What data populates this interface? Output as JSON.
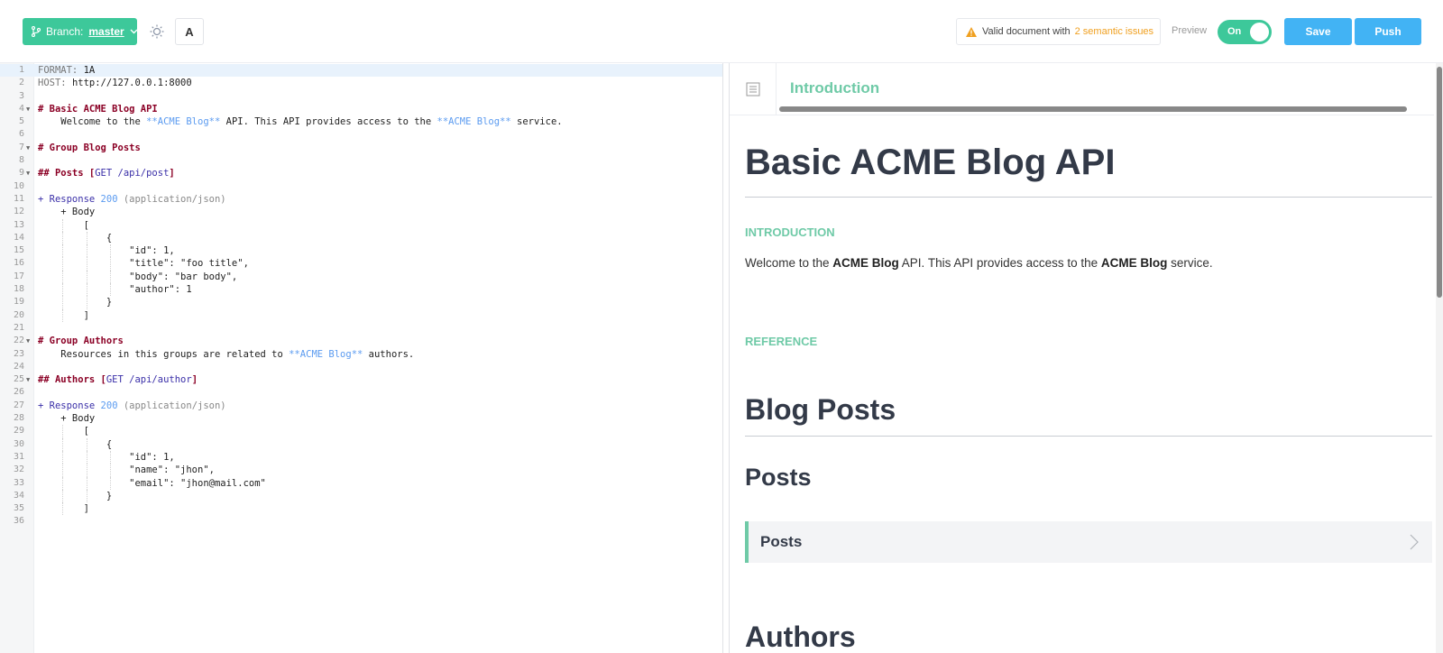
{
  "toolbar": {
    "branch_prefix": "Branch:",
    "branch_name": "master",
    "font_label": "A",
    "status_text": "Valid document with",
    "status_issues": "2 semantic issues",
    "preview_label": "Preview",
    "toggle_state": "On",
    "save_label": "Save",
    "push_label": "Push",
    "accent_color": "#3dc89a",
    "primary_color": "#42b3f4",
    "warning_color": "#f0a020"
  },
  "editor": {
    "lines": [
      {
        "n": "1",
        "fold": false,
        "active": true,
        "indent": 0,
        "parts": [
          {
            "t": "FORMAT: ",
            "c": "c-key"
          },
          {
            "t": "1A",
            "c": ""
          }
        ]
      },
      {
        "n": "2",
        "fold": false,
        "indent": 0,
        "parts": [
          {
            "t": "HOST: ",
            "c": "c-key"
          },
          {
            "t": "http://127.0.0.1:8000",
            "c": ""
          }
        ]
      },
      {
        "n": "3",
        "fold": false,
        "indent": 0,
        "parts": []
      },
      {
        "n": "4",
        "fold": true,
        "indent": 0,
        "parts": [
          {
            "t": "# Basic ACME Blog API",
            "c": "c-head"
          }
        ]
      },
      {
        "n": "5",
        "fold": false,
        "indent": 0,
        "parts": [
          {
            "t": "    Welcome to the ",
            "c": ""
          },
          {
            "t": "**ACME Blog**",
            "c": "c-link"
          },
          {
            "t": " API. This API provides access to the ",
            "c": ""
          },
          {
            "t": "**ACME Blog**",
            "c": "c-link"
          },
          {
            "t": " service.",
            "c": ""
          }
        ]
      },
      {
        "n": "6",
        "fold": false,
        "indent": 0,
        "parts": []
      },
      {
        "n": "7",
        "fold": true,
        "indent": 0,
        "parts": [
          {
            "t": "# Group Blog Posts",
            "c": "c-head"
          }
        ]
      },
      {
        "n": "8",
        "fold": false,
        "indent": 0,
        "parts": []
      },
      {
        "n": "9",
        "fold": true,
        "indent": 0,
        "parts": [
          {
            "t": "## Posts [",
            "c": "c-head"
          },
          {
            "t": "GET /api/post",
            "c": "c-path"
          },
          {
            "t": "]",
            "c": "c-head"
          }
        ]
      },
      {
        "n": "10",
        "fold": false,
        "indent": 0,
        "parts": []
      },
      {
        "n": "11",
        "fold": false,
        "indent": 0,
        "parts": [
          {
            "t": "+ Response ",
            "c": "c-plus"
          },
          {
            "t": "200",
            "c": "c-num"
          },
          {
            "t": " (application/json)",
            "c": "c-type"
          }
        ]
      },
      {
        "n": "12",
        "fold": false,
        "indent": 0,
        "parts": [
          {
            "t": "    + Body",
            "c": ""
          }
        ]
      },
      {
        "n": "13",
        "fold": false,
        "indent": 1,
        "parts": [
          {
            "t": "        [",
            "c": ""
          }
        ]
      },
      {
        "n": "14",
        "fold": false,
        "indent": 2,
        "parts": [
          {
            "t": "            {",
            "c": ""
          }
        ]
      },
      {
        "n": "15",
        "fold": false,
        "indent": 3,
        "parts": [
          {
            "t": "                \"id\": 1,",
            "c": ""
          }
        ]
      },
      {
        "n": "16",
        "fold": false,
        "indent": 3,
        "parts": [
          {
            "t": "                \"title\": \"foo title\",",
            "c": ""
          }
        ]
      },
      {
        "n": "17",
        "fold": false,
        "indent": 3,
        "parts": [
          {
            "t": "                \"body\": \"bar body\",",
            "c": ""
          }
        ]
      },
      {
        "n": "18",
        "fold": false,
        "indent": 3,
        "parts": [
          {
            "t": "                \"author\": 1",
            "c": ""
          }
        ]
      },
      {
        "n": "19",
        "fold": false,
        "indent": 2,
        "parts": [
          {
            "t": "            }",
            "c": ""
          }
        ]
      },
      {
        "n": "20",
        "fold": false,
        "indent": 1,
        "parts": [
          {
            "t": "        ]",
            "c": ""
          }
        ]
      },
      {
        "n": "21",
        "fold": false,
        "indent": 0,
        "parts": []
      },
      {
        "n": "22",
        "fold": true,
        "indent": 0,
        "parts": [
          {
            "t": "# Group Authors",
            "c": "c-head"
          }
        ]
      },
      {
        "n": "23",
        "fold": false,
        "indent": 0,
        "parts": [
          {
            "t": "    Resources in this groups are related to ",
            "c": ""
          },
          {
            "t": "**ACME Blog**",
            "c": "c-link"
          },
          {
            "t": " authors.",
            "c": ""
          }
        ]
      },
      {
        "n": "24",
        "fold": false,
        "indent": 0,
        "parts": []
      },
      {
        "n": "25",
        "fold": true,
        "indent": 0,
        "parts": [
          {
            "t": "## Authors [",
            "c": "c-head"
          },
          {
            "t": "GET /api/author",
            "c": "c-path"
          },
          {
            "t": "]",
            "c": "c-head"
          }
        ]
      },
      {
        "n": "26",
        "fold": false,
        "indent": 0,
        "parts": []
      },
      {
        "n": "27",
        "fold": false,
        "indent": 0,
        "parts": [
          {
            "t": "+ Response ",
            "c": "c-plus"
          },
          {
            "t": "200",
            "c": "c-num"
          },
          {
            "t": " (application/json)",
            "c": "c-type"
          }
        ]
      },
      {
        "n": "28",
        "fold": false,
        "indent": 0,
        "parts": [
          {
            "t": "    + Body",
            "c": ""
          }
        ]
      },
      {
        "n": "29",
        "fold": false,
        "indent": 1,
        "parts": [
          {
            "t": "        [",
            "c": ""
          }
        ]
      },
      {
        "n": "30",
        "fold": false,
        "indent": 2,
        "parts": [
          {
            "t": "            {",
            "c": ""
          }
        ]
      },
      {
        "n": "31",
        "fold": false,
        "indent": 3,
        "parts": [
          {
            "t": "                \"id\": 1,",
            "c": ""
          }
        ]
      },
      {
        "n": "32",
        "fold": false,
        "indent": 3,
        "parts": [
          {
            "t": "                \"name\": \"jhon\",",
            "c": ""
          }
        ]
      },
      {
        "n": "33",
        "fold": false,
        "indent": 3,
        "parts": [
          {
            "t": "                \"email\": \"jhon@mail.com\"",
            "c": ""
          }
        ]
      },
      {
        "n": "34",
        "fold": false,
        "indent": 2,
        "parts": [
          {
            "t": "            }",
            "c": ""
          }
        ]
      },
      {
        "n": "35",
        "fold": false,
        "indent": 1,
        "parts": [
          {
            "t": "        ]",
            "c": ""
          }
        ]
      },
      {
        "n": "36",
        "fold": false,
        "indent": 0,
        "parts": []
      }
    ]
  },
  "preview": {
    "tab_label": "Introduction",
    "title": "Basic ACME Blog API",
    "intro_heading": "INTRODUCTION",
    "intro_p1": "Welcome to the ",
    "intro_b1": "ACME Blog",
    "intro_p2": " API. This API provides access to the ",
    "intro_b2": "ACME Blog",
    "intro_p3": " service.",
    "reference_heading": "REFERENCE",
    "group1": "Blog Posts",
    "resource1": "Posts",
    "action1": "Posts",
    "group2": "Authors"
  }
}
